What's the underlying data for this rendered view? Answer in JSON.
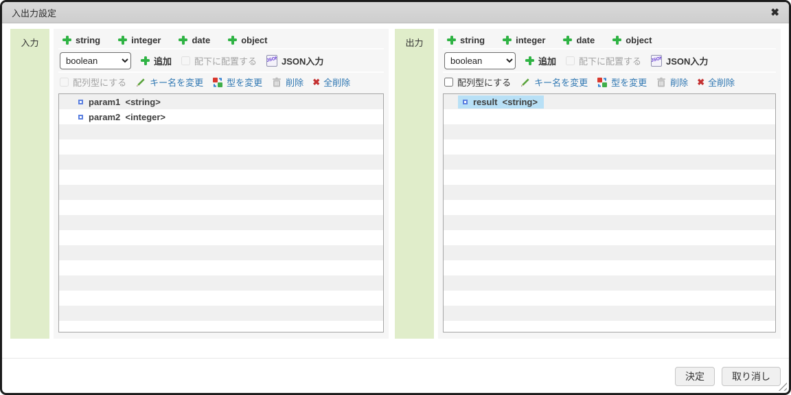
{
  "dialog": {
    "title": "入出力設定",
    "close_icon": "✖"
  },
  "panels": [
    {
      "label": "入力",
      "add_type_buttons": [
        "string",
        "integer",
        "date",
        "object"
      ],
      "type_select_value": "boolean",
      "add_label": "追加",
      "place_under_label": "配下に配置する",
      "json_input_label": "JSON入力",
      "array_type_label": "配列型にする",
      "rename_key_label": "キー名を変更",
      "change_type_label": "型を変更",
      "delete_label": "削除",
      "delete_all_label": "全削除",
      "delete_all_icon": "✖",
      "items": [
        {
          "name": "param1",
          "type": "<string>",
          "selected": false
        },
        {
          "name": "param2",
          "type": "<integer>",
          "selected": false
        }
      ]
    },
    {
      "label": "出力",
      "add_type_buttons": [
        "string",
        "integer",
        "date",
        "object"
      ],
      "type_select_value": "boolean",
      "add_label": "追加",
      "place_under_label": "配下に配置する",
      "json_input_label": "JSON入力",
      "array_type_label": "配列型にする",
      "rename_key_label": "キー名を変更",
      "change_type_label": "型を変更",
      "delete_label": "削除",
      "delete_all_label": "全削除",
      "delete_all_icon": "✖",
      "items": [
        {
          "name": "result",
          "type": "<string>",
          "selected": true
        }
      ]
    }
  ],
  "footer": {
    "ok_label": "決定",
    "cancel_label": "取り消し"
  },
  "colors": {
    "accent_green": "#2fb344",
    "link_blue": "#2f77b2",
    "selection_blue": "#b8e0f6",
    "panel_label_green": "#e0edca",
    "delete_all_red": "#c43131",
    "stripe_gray": "#f0f0f0",
    "titlebar_gray": "#d4d4d4"
  }
}
